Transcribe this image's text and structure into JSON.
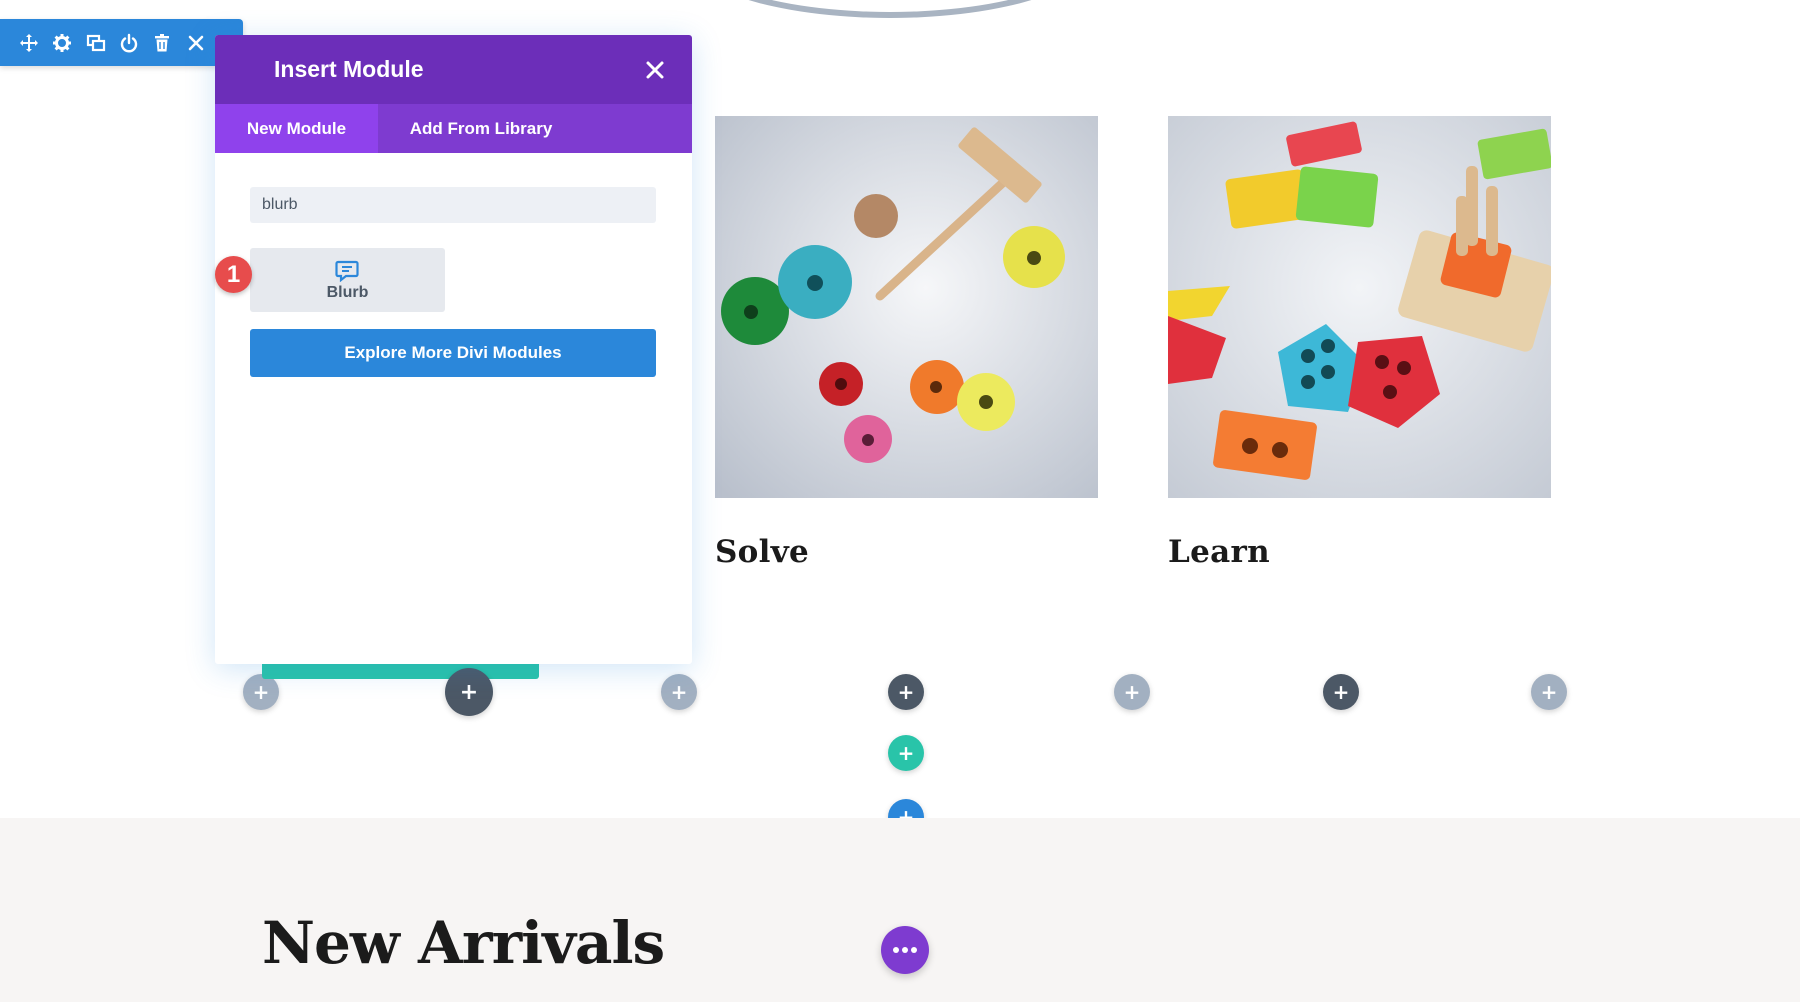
{
  "section_toolbar": {
    "icons": [
      "move-icon",
      "gear-icon",
      "duplicate-icon",
      "power-icon",
      "trash-icon",
      "close-icon",
      "more-icon"
    ]
  },
  "modal": {
    "title": "Insert Module",
    "tabs": [
      {
        "label": "New Module",
        "active": true
      },
      {
        "label": "Add From Library",
        "active": false
      }
    ],
    "search": {
      "value": "blurb",
      "placeholder": ""
    },
    "results": [
      {
        "label": "Blurb",
        "icon": "chat-bubble-icon"
      }
    ],
    "explore_label": "Explore More Divi Modules",
    "step_badge": "1"
  },
  "columns": [
    {
      "title": "Solve",
      "image": "toy-hammer-rings-photo"
    },
    {
      "title": "Learn",
      "image": "shape-sorter-blocks-photo"
    }
  ],
  "bottom": {
    "heading": "New Arrivals"
  },
  "colors": {
    "section_blue": "#2b87da",
    "modal_purple": "#6c2eb9",
    "tab_purple": "#7e3bd0",
    "active_tab": "#8f42ec",
    "row_teal": "#29c4a9",
    "module_dark": "#4c5866",
    "module_gray": "#a2b0c1",
    "badge_red": "#e74c4c"
  }
}
